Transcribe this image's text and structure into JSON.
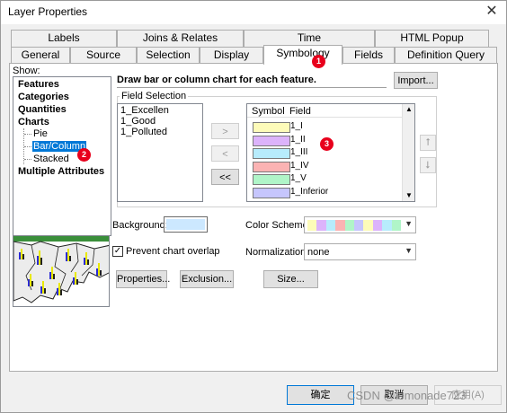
{
  "window": {
    "title": "Layer Properties",
    "close_glyph": "✕"
  },
  "tabs_row1": [
    "Labels",
    "Joins & Relates",
    "Time",
    "HTML Popup"
  ],
  "tabs_row2": [
    "General",
    "Source",
    "Selection",
    "Display",
    "Symbology",
    "Fields",
    "Definition Query"
  ],
  "show": {
    "label": "Show:",
    "items": [
      "Features",
      "Categories",
      "Quantities",
      "Charts",
      "Pie",
      "Bar/Column",
      "Stacked",
      "Multiple Attributes"
    ]
  },
  "header": {
    "description": "Draw bar or column chart for each feature.",
    "import_label": "Import..."
  },
  "field_selection": {
    "label": "Field Selection",
    "fields": [
      "1_Excellen",
      "1_Good",
      "1_Polluted"
    ],
    "add_label": ">",
    "remove_label": "<",
    "remove_all_label": "<<",
    "symbol_header": "Symbol",
    "field_header": "Field",
    "symbols": [
      {
        "field": "1_I",
        "color": "#fdfbb9"
      },
      {
        "field": "1_II",
        "color": "#dcb3fb"
      },
      {
        "field": "1_III",
        "color": "#b7ecfc"
      },
      {
        "field": "1_IV",
        "color": "#fbb3b3"
      },
      {
        "field": "1_V",
        "color": "#b0f5c8"
      },
      {
        "field": "1_Inferior",
        "color": "#c6c6fd"
      }
    ]
  },
  "background": {
    "label": "Background:",
    "color": "#cce8ff"
  },
  "color_scheme": {
    "label": "Color Scheme:",
    "colors": [
      "#fdfbb9",
      "#dcb3fb",
      "#b7ecfc",
      "#fbb3b3",
      "#b0f5c8",
      "#c6c6fd",
      "#fdfbb9",
      "#dcb3fb",
      "#b7ecfc",
      "#b0f5c8"
    ]
  },
  "prevent_overlap": {
    "label": "Prevent chart overlap",
    "checked": true
  },
  "normalization": {
    "label": "Normalization:",
    "value": "none"
  },
  "buttons": {
    "properties": "Properties...",
    "exclusion": "Exclusion...",
    "size": "Size..."
  },
  "footer": {
    "ok": "确定",
    "cancel": "取消",
    "apply": "应用(A)",
    "watermark": "CSDN @lemonade723"
  },
  "badges": [
    "1",
    "2",
    "3"
  ]
}
